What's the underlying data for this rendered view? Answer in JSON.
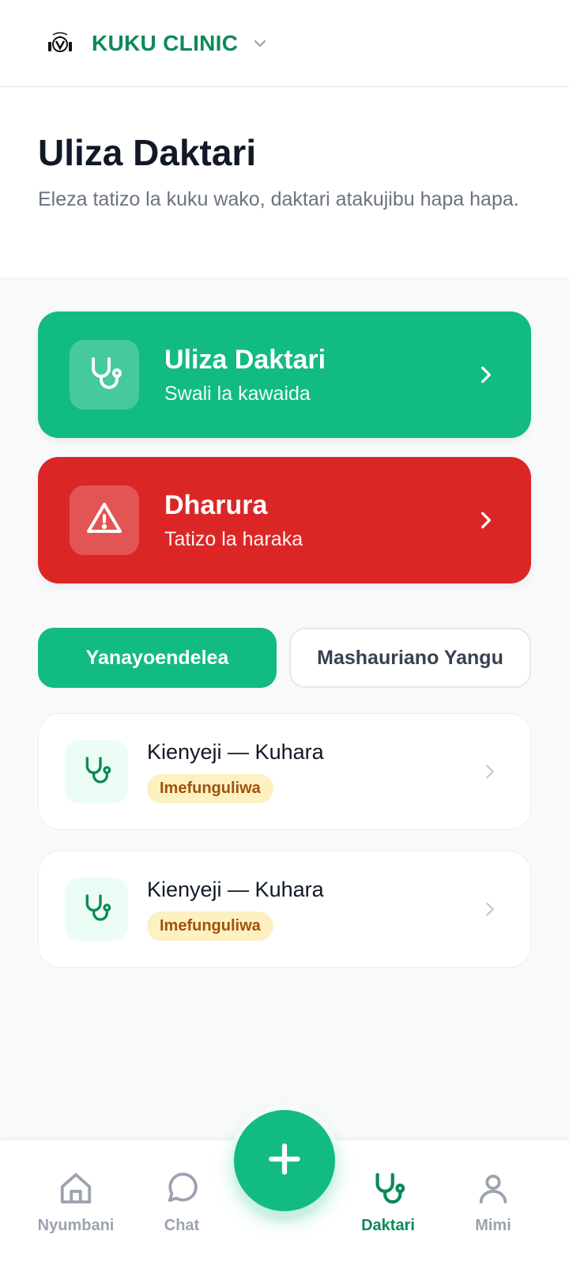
{
  "topbar": {
    "brand_name": "KUKU CLINIC",
    "logo_icon": "rooster-logo-icon",
    "chevron_icon": "chevron-down-icon"
  },
  "header": {
    "title": "Uliza Daktari",
    "subtitle": "Eleza tatizo la kuku wako, daktari atakujibu hapa hapa."
  },
  "actions": [
    {
      "title": "Uliza Daktari",
      "subtitle": "Swali la kawaida",
      "icon": "stethoscope-icon",
      "color": "#12bb82"
    },
    {
      "title": "Dharura",
      "subtitle": "Tatizo la haraka",
      "icon": "warning-icon",
      "color": "#dc2626"
    }
  ],
  "tabs": [
    {
      "label": "Yanayoendelea",
      "active": true
    },
    {
      "label": "Mashauriano Yangu",
      "active": false
    }
  ],
  "consultations": [
    {
      "title": "Kienyeji — Kuhara",
      "status": "Imefunguliwa",
      "icon": "stethoscope-icon"
    },
    {
      "title": "Kienyeji — Kuhara",
      "status": "Imefunguliwa",
      "icon": "stethoscope-icon"
    }
  ],
  "bottom_nav": {
    "items": [
      {
        "label": "Nyumbani",
        "icon": "home-icon",
        "active": false
      },
      {
        "label": "Chat",
        "icon": "chat-bubble-icon",
        "active": false
      },
      {
        "label": "Daktari",
        "icon": "stethoscope-icon",
        "active": true
      },
      {
        "label": "Mimi",
        "icon": "user-icon",
        "active": false
      }
    ],
    "fab_icon": "plus-icon"
  },
  "colors": {
    "primary": "#12bb82",
    "brand_text": "#0c8a58",
    "danger": "#dc2626",
    "badge_bg": "#fdf1c2",
    "badge_text": "#a0520e"
  }
}
